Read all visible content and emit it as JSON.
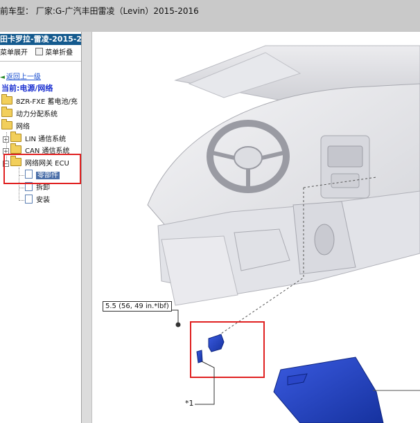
{
  "window": {
    "title": "前车型：  厂家:G-广汽丰田雷凌（Levin）2015-2016"
  },
  "sidebar": {
    "header": "田卡罗拉-雷凌-2015-2",
    "tools": {
      "expand_label": "菜单展开",
      "collapse_label": "菜单折叠"
    },
    "back_link": "返回上一级",
    "current_label": "当前:电源/网络",
    "items": [
      {
        "label": "8ZR-FXE 蓄电池/充"
      },
      {
        "label": "动力分配系统"
      },
      {
        "label": "网络"
      },
      {
        "label": "LIN 通信系统"
      },
      {
        "label": "CAN 通信系统"
      },
      {
        "label": "网络网关 ECU"
      },
      {
        "label": "零部件",
        "selected": true
      },
      {
        "label": "拆卸"
      },
      {
        "label": "安装"
      }
    ]
  },
  "diagram": {
    "torque_label": "5.5 (56, 49 in.*lbf)",
    "callout_label": "*1"
  },
  "colors": {
    "topbar": "#c9c9c9",
    "sidebar_header": "#145a8e",
    "highlight_box": "#e02020",
    "part_blue": "#1e3fbf"
  }
}
